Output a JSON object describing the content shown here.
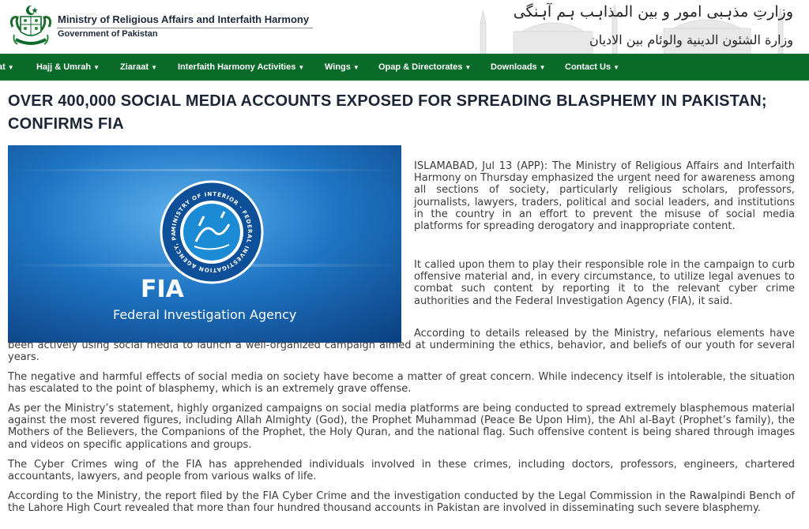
{
  "header": {
    "ministry_name": "Ministry of Religious Affairs and Interfaith Harmony",
    "government": "Government of Pakistan",
    "urdu_title": "وزارتِ مذہبی امور و بین المذاہب ہم آہنگی",
    "arabic_title": "وزارة الشئون الدينية والوئام بين الاديان",
    "emblem_icon": "pakistan-state-emblem-icon"
  },
  "nav": {
    "items": [
      {
        "label": "at"
      },
      {
        "label": "Hajj & Umrah"
      },
      {
        "label": "Ziaraat"
      },
      {
        "label": "Interfaith Harmony Activities"
      },
      {
        "label": "Wings"
      },
      {
        "label": "Opap & Directorates"
      },
      {
        "label": "Downloads"
      },
      {
        "label": "Contact Us"
      }
    ],
    "chevron": "chevron-down-icon"
  },
  "article": {
    "title": "OVER 400,000 SOCIAL MEDIA ACCOUNTS EXPOSED FOR SPREADING BLASPHEMY IN PAKISTAN; CONFIRMS FIA",
    "image": {
      "ring_text": "MINISTRY OF INTERIOR · FEDERAL INVESTIGATION AGENCY, PAKISTAN",
      "acronym": "FIA",
      "name": "Federal Investigation Agency"
    },
    "paragraphs": [
      "ISLAMABAD, Jul 13 (APP): The Ministry of Religious Affairs and Interfaith Harmony on Thursday emphasized the urgent need for awareness among all sections of society, particularly religious scholars, professors, journalists, lawyers, traders, political and social leaders, and institutions in the country in an effort to prevent the misuse of social media platforms for spreading derogatory and inappropriate content.",
      "It called upon them to play their responsible role in the campaign to curb offensive material and, in every circumstance, to utilize legal avenues to combat such content by reporting it to the relevant cyber crime authorities and the Federal Investigation Agency (FIA), it said.",
      "According to details released by the Ministry, nefarious elements have been actively using social media to launch a well-organized campaign aimed at undermining the ethics, behavior, and beliefs of our youth for several years.",
      "The negative and harmful effects of social media on society have become a matter of great concern. While indecency itself is intolerable, the situation has escalated to the point of blasphemy, which is an extremely grave offense.",
      "As per the Ministry’s statement, highly organized campaigns on social media platforms are being conducted to spread extremely blasphemous material against the most revered figures, including Allah Almighty (God), the Prophet Muhammad (Peace Be Upon Him), the Ahl al-Bayt (Prophet’s family), the Mothers of the Believers, the Companions of the Prophet, the Holy Quran, and the national flag. Such offensive content is being shared through images and videos on specific applications and groups.",
      "The Cyber Crimes wing of the FIA has apprehended individuals involved in these crimes, including doctors, professors, engineers, chartered accountants, lawyers, and people from various walks of life.",
      "According to the Ministry, the report filed by the FIA Cyber Crime and the investigation conducted by the Legal Commission in the Rawalpindi Bench of the Lahore High Court revealed that more than four hundred thousand accounts in Pakistan are involved in disseminating such severe blasphemy."
    ]
  },
  "colors": {
    "nav_bg": "#0b6b2a",
    "title": "#1b2535",
    "body_text": "#3c3c3c",
    "hero_blue": "#1466b8",
    "seal_blue": "#0e4f9a"
  }
}
